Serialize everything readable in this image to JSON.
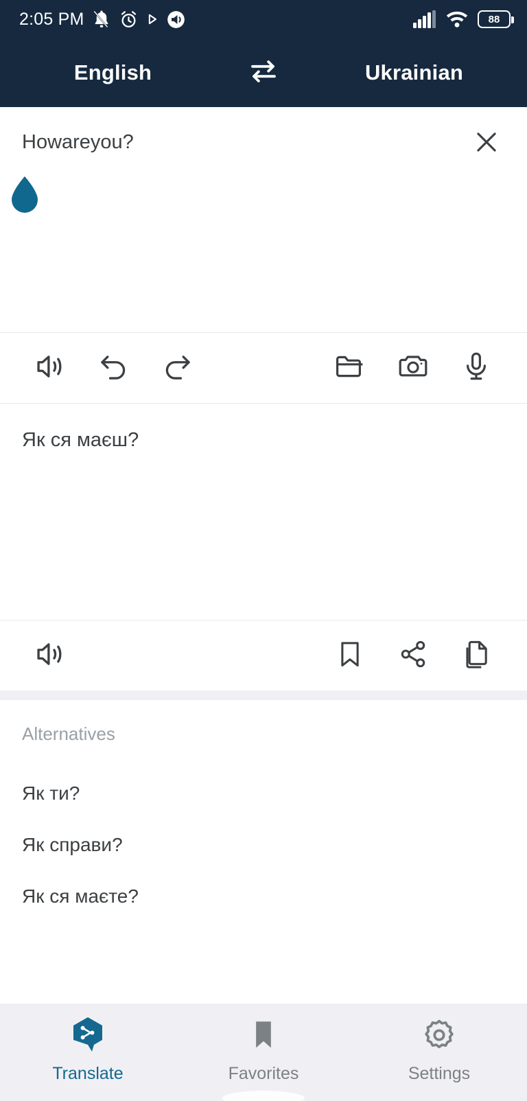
{
  "statusbar": {
    "time": "2:05 PM",
    "icons_left": [
      "bell-muted-icon",
      "alarm-clock-icon",
      "play-triangle-icon",
      "sound-circle-icon"
    ],
    "icons_right": [
      "cellular-signal-icon",
      "wifi-icon",
      "battery-icon"
    ],
    "battery_level": "88"
  },
  "header": {
    "source_language": "English",
    "target_language": "Ukrainian",
    "swap_icon": "swap-horizontal-icon",
    "background_color": "#16293F",
    "text_color": "#FFFFFF"
  },
  "source": {
    "text": "Howareyou?",
    "clear_icon": "close-icon",
    "cursor_handle_icon": "text-cursor-handle-icon",
    "cursor_handle_color": "#11688E"
  },
  "source_toolbar": {
    "left": [
      {
        "name": "speak-source-button",
        "icon": "speaker-icon"
      },
      {
        "name": "undo-button",
        "icon": "undo-arrow-icon"
      },
      {
        "name": "redo-button",
        "icon": "redo-arrow-icon"
      }
    ],
    "right": [
      {
        "name": "open-file-button",
        "icon": "folder-icon"
      },
      {
        "name": "camera-button",
        "icon": "camera-icon"
      },
      {
        "name": "microphone-button",
        "icon": "microphone-icon"
      }
    ]
  },
  "target": {
    "text": "Як ся маєш?"
  },
  "target_toolbar": {
    "left": [
      {
        "name": "speak-target-button",
        "icon": "speaker-icon"
      }
    ],
    "right": [
      {
        "name": "bookmark-button",
        "icon": "bookmark-icon"
      },
      {
        "name": "share-button",
        "icon": "share-icon"
      },
      {
        "name": "copy-button",
        "icon": "copy-icon"
      }
    ]
  },
  "alternatives": {
    "title": "Alternatives",
    "items": [
      "Як ти?",
      "Як справи?",
      "Як ся маєте?"
    ]
  },
  "bottom_nav": {
    "active_color": "#15688F",
    "inactive_color": "#7C8185",
    "items": [
      {
        "label": "Translate",
        "icon": "translate-hexagon-icon",
        "active": true
      },
      {
        "label": "Favorites",
        "icon": "bookmark-filled-icon",
        "active": false
      },
      {
        "label": "Settings",
        "icon": "gear-icon",
        "active": false
      }
    ]
  }
}
